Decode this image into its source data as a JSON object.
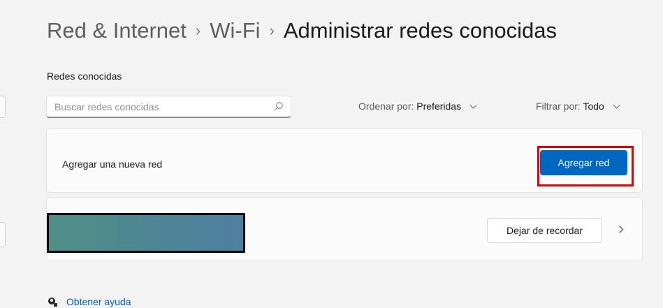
{
  "breadcrumb": {
    "items": [
      "Red & Internet",
      "Wi-Fi"
    ],
    "separator": "›",
    "current": "Administrar redes conocidas"
  },
  "known_networks": {
    "section_title": "Redes conocidas",
    "search_placeholder": "Buscar redes conocidas",
    "sort_label": "Ordenar por:",
    "sort_value": "Preferidas",
    "filter_label": "Filtrar por:",
    "filter_value": "Todo"
  },
  "add_network": {
    "label": "Agregar una nueva red",
    "button_label": "Agregar red"
  },
  "network_item": {
    "forget_button_label": "Dejar de recordar"
  },
  "help": {
    "link_label": "Obtener ayuda"
  },
  "colors": {
    "accent": "#0067c0",
    "highlight_border": "#e00000",
    "link": "#005fb8",
    "background": "#f3f3f3"
  },
  "icons": [
    "search-icon",
    "chevron-down-icon",
    "chevron-right-icon",
    "help-icon"
  ]
}
